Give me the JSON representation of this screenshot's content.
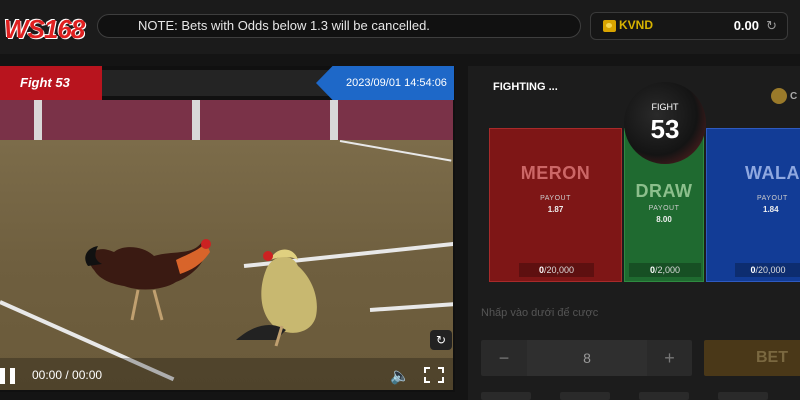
{
  "header": {
    "logo_text": "WS168",
    "notice": "NOTE: Bets with Odds below 1.3 will be cancelled.",
    "currency": "KVND",
    "balance": "0.00",
    "icons": {
      "coin": "coin-icon",
      "refresh": "refresh-icon"
    }
  },
  "video": {
    "fight_label": "Fight 53",
    "datetime": "2023/09/01 14:54:06",
    "time": "00:00 / 00:00",
    "icons": {
      "pause": "pause-icon",
      "volume": "volume-icon",
      "fullscreen": "fullscreen-icon",
      "replay": "replay-icon"
    }
  },
  "betting": {
    "status": "FIGHTING ...",
    "corner_label": "C",
    "fight_label": "FIGHT",
    "fight_number": "53",
    "cards": [
      {
        "name": "MERON",
        "payout_label": "PAYOUT",
        "payout": "1.87",
        "current": "0",
        "limit": "/20,000",
        "color": "#8e1414"
      },
      {
        "name": "DRAW",
        "payout_label": "PAYOUT",
        "payout": "8.00",
        "current": "0",
        "limit": "/2,000",
        "color": "#1f6a30"
      },
      {
        "name": "WALA",
        "payout_label": "PAYOUT",
        "payout": "1.84",
        "current": "0",
        "limit": "/20,000",
        "color": "#123c96"
      }
    ],
    "hint": "Nhấp vào dưới để cược",
    "stepper": {
      "minus": "−",
      "value": "8",
      "plus": "+"
    },
    "bet_button": "BET"
  }
}
